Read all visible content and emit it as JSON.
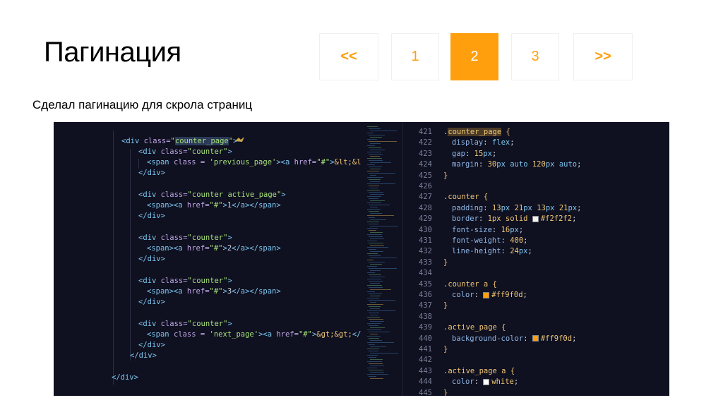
{
  "title": "Пагинация",
  "subtitle": "Сделал пагинацию для скрола страниц",
  "pagination": [
    {
      "label": "<<",
      "state": "nav"
    },
    {
      "label": "1",
      "state": "normal"
    },
    {
      "label": "2",
      "state": "active"
    },
    {
      "label": "3",
      "state": "normal"
    },
    {
      "label": ">>",
      "state": "nav"
    }
  ],
  "colors": {
    "accent": "#ff9f0d",
    "editor_bg": "#0f1020",
    "border": "#f2f2f2"
  },
  "html_code": [
    "<div class=\"counter_page\">",
    "<div class=\"counter\">",
    "<span class = 'previous_page'><a href=\"#\">&lt;&lt",
    "</div>",
    "<div class=\"counter active_page\">",
    "<span><a href=\"#\">1</a></span>",
    "</div>",
    "<div class=\"counter\">",
    "<span><a href=\"#\">2</a></span>",
    "</div>",
    "<div class=\"counter\">",
    "<span><a href=\"#\">3</a></span>",
    "</div>",
    "<div class=\"counter\">",
    "<span class = 'next_page'><a href=\"#\">&gt;&gt;</a",
    "</div>",
    "</div>",
    "</div>"
  ],
  "line_numbers": [
    "421",
    "422",
    "423",
    "424",
    "425",
    "426",
    "427",
    "428",
    "429",
    "430",
    "431",
    "432",
    "433",
    "434",
    "435",
    "436",
    "437",
    "438",
    "439",
    "440",
    "441",
    "442",
    "443",
    "444",
    "445"
  ],
  "css_code": [
    ".counter_page {",
    "display: flex;",
    "gap: 15px;",
    "margin: 30px auto 120px auto;",
    "}",
    "",
    ".counter {",
    "padding: 13px 21px 13px 21px;",
    "border: 1px solid #f2f2f2;",
    "font-size: 16px;",
    "font-weight: 400;",
    "line-height: 24px;",
    "}",
    "",
    ".counter a {",
    "color: #ff9f0d;",
    "}",
    "",
    ".active_page {",
    "background-color: #ff9f0d;",
    "}",
    "",
    ".active_page a {",
    "color: white;",
    "}"
  ]
}
